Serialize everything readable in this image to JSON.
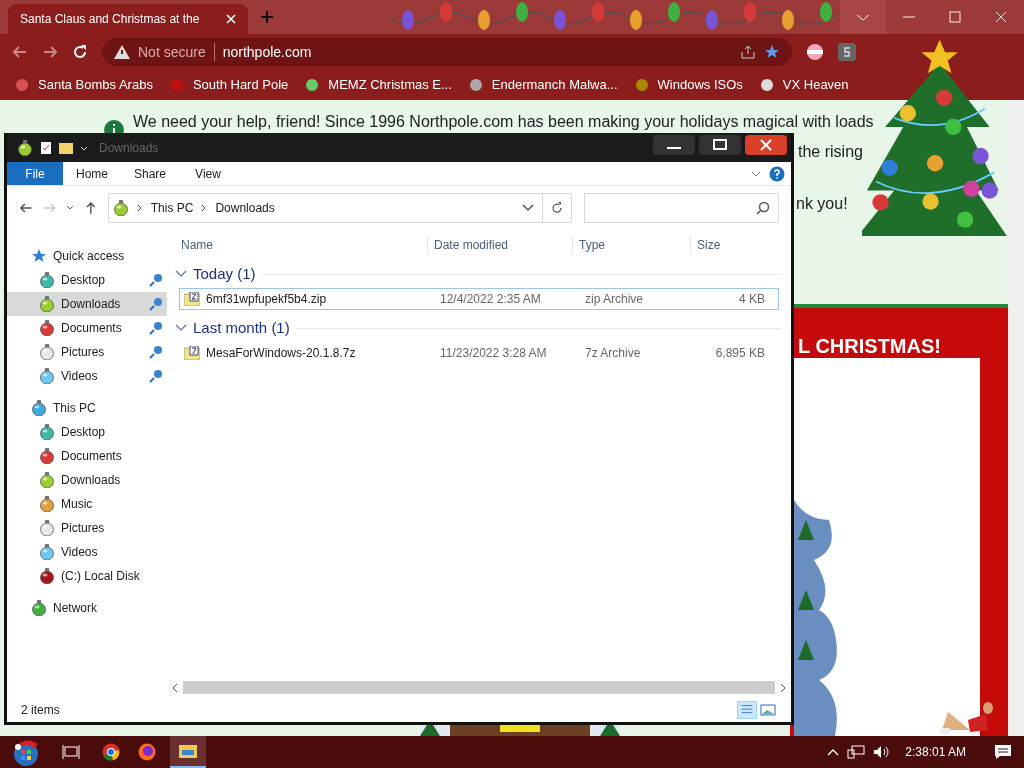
{
  "browser": {
    "tab": {
      "title": "Santa Claus and Christmas at the",
      "selected": true
    },
    "address": {
      "security": "Not secure",
      "url": "northpole.com"
    },
    "bookmarks": [
      "Santa Bombs Arabs",
      "South Hard Pole",
      "MEMZ Christmas E...",
      "Endermanch Malwa...",
      "Windows ISOs",
      "VX Heaven"
    ]
  },
  "page": {
    "notice": [
      "We need your help, friend! Since 1996 Northpole.com has been making your holidays magical with loads",
      "the rising",
      "nk you!"
    ],
    "banner": "L CHRISTMAS!"
  },
  "explorer": {
    "title": "Downloads",
    "ribbon_tabs": [
      {
        "label": "File",
        "kind": "file"
      },
      {
        "label": "Home",
        "kind": "tab"
      },
      {
        "label": "Share",
        "kind": "tab"
      },
      {
        "label": "View",
        "kind": "tab"
      }
    ],
    "breadcrumb": [
      "This PC",
      "Downloads"
    ],
    "columns": [
      "Name",
      "Date modified",
      "Type",
      "Size"
    ],
    "groups": [
      {
        "title": "Today (1)",
        "expanded": true,
        "files": [
          {
            "name": "6mf31wpfupekf5b4.zip",
            "date": "12/4/2022 2:35 AM",
            "type": "zip Archive",
            "size": "4 KB",
            "selected": true,
            "kind": "zip"
          }
        ]
      },
      {
        "title": "Last month (1)",
        "expanded": true,
        "files": [
          {
            "name": "MesaForWindows-20.1.8.7z",
            "date": "11/23/2022 3:28 AM",
            "type": "7z Archive",
            "size": "6,895 KB",
            "selected": false,
            "kind": "sevenzip"
          }
        ]
      }
    ],
    "nav": [
      {
        "label": "Quick access",
        "kind": "star",
        "children": [
          {
            "label": "Desktop",
            "kind": "desktop",
            "pinned": true,
            "selected": false
          },
          {
            "label": "Downloads",
            "kind": "downloads",
            "pinned": true,
            "selected": true
          },
          {
            "label": "Documents",
            "kind": "documents",
            "pinned": true,
            "selected": false
          },
          {
            "label": "Pictures",
            "kind": "pictures",
            "pinned": true,
            "selected": false
          },
          {
            "label": "Videos",
            "kind": "videos",
            "pinned": true,
            "selected": false
          }
        ]
      },
      {
        "label": "This PC",
        "kind": "pc",
        "children": [
          {
            "label": "Desktop",
            "kind": "desktop",
            "pinned": false,
            "selected": false
          },
          {
            "label": "Documents",
            "kind": "documents",
            "pinned": false,
            "selected": false
          },
          {
            "label": "Downloads",
            "kind": "downloads",
            "pinned": false,
            "selected": false
          },
          {
            "label": "Music",
            "kind": "music",
            "pinned": false,
            "selected": false
          },
          {
            "label": "Pictures",
            "kind": "pictures",
            "pinned": false,
            "selected": false
          },
          {
            "label": "Videos",
            "kind": "videos",
            "pinned": false,
            "selected": false
          },
          {
            "label": "(C:) Local Disk",
            "kind": "disk",
            "pinned": false,
            "selected": false
          }
        ]
      },
      {
        "label": "Network",
        "kind": "network"
      }
    ],
    "status": "2 items"
  },
  "taskbar": {
    "clock": "2:38:01 AM"
  }
}
